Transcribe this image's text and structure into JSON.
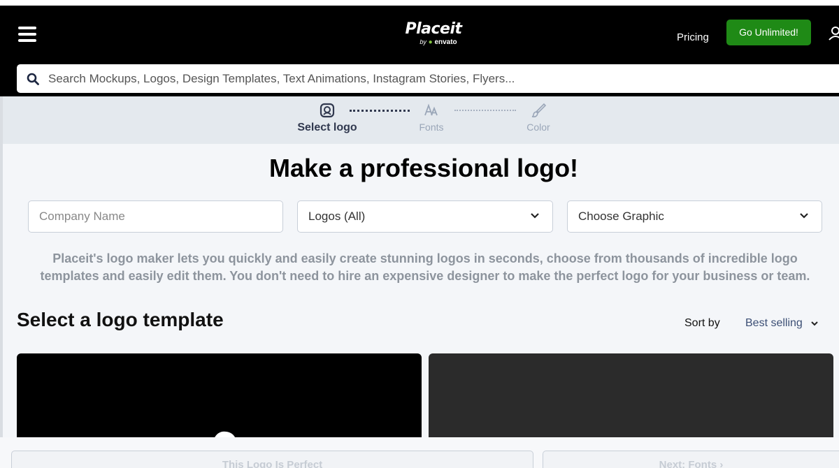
{
  "header": {
    "brand_name": "Placeit",
    "brand_by": "by",
    "brand_partner": "envato",
    "pricing_label": "Pricing",
    "cta_label": "Go Unlimited!"
  },
  "search": {
    "placeholder": "Search Mockups, Logos, Design Templates, Text Animations, Instagram Stories, Flyers..."
  },
  "steps": [
    {
      "label": "Select logo",
      "icon": "logo-select-icon",
      "active": true
    },
    {
      "label": "Fonts",
      "icon": "fonts-icon",
      "active": false
    },
    {
      "label": "Color",
      "icon": "brush-icon",
      "active": false
    }
  ],
  "hero": {
    "title": "Make a professional logo!",
    "company_placeholder": "Company Name",
    "logos_select_value": "Logos (All)",
    "graphic_select_value": "Choose Graphic",
    "description": "Placeit's logo maker lets you quickly and easily create stunning logos in seconds, choose from thousands of incredible logo templates and easily edit them. You don't need to hire an expensive designer to make the perfect logo for your business or team."
  },
  "templates": {
    "section_title": "Select a logo template",
    "sort_label": "Sort by",
    "sort_value": "Best selling"
  },
  "footer": {
    "perfect_label": "This Logo Is Perfect",
    "next_label": "Next: Fonts"
  },
  "colors": {
    "header_bg": "#000000",
    "cta_bg": "#1f8a16",
    "steps_bg": "#e4e9ee",
    "active_step": "#31394f",
    "sort_value": "#3c4f75"
  }
}
